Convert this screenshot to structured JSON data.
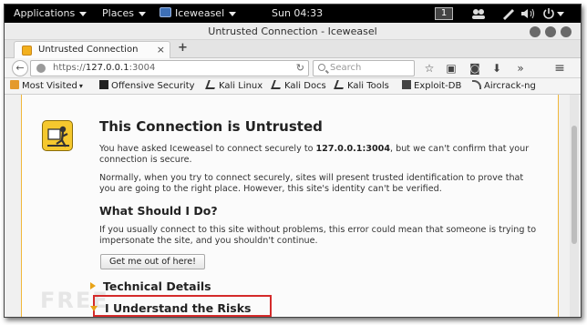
{
  "topbar": {
    "applications": "Applications",
    "places": "Places",
    "app_name": "Iceweasel",
    "clock": "Sun 04:33",
    "workspace": "1"
  },
  "window": {
    "title": "Untrusted Connection - Iceweasel"
  },
  "tabs": [
    {
      "label": "Untrusted Connection"
    }
  ],
  "navbar": {
    "url_scheme": "https://",
    "url_host": "127.0.0.1",
    "url_port": ":3004",
    "search_placeholder": "Search"
  },
  "bookmarks": [
    {
      "label": "Most Visited",
      "icon": "folder-icon"
    },
    {
      "label": "Offensive Security",
      "icon": "offsec-icon"
    },
    {
      "label": "Kali Linux",
      "icon": "kali-dragon-icon"
    },
    {
      "label": "Kali Docs",
      "icon": "kali-dragon-icon"
    },
    {
      "label": "Kali Tools",
      "icon": "kali-dragon-icon"
    },
    {
      "label": "Exploit-DB",
      "icon": "exploitdb-icon"
    },
    {
      "label": "Aircrack-ng",
      "icon": "aircrack-icon"
    }
  ],
  "page": {
    "heading": "This Connection is Untrusted",
    "intro_pre": "You have asked Iceweasel to connect securely to ",
    "intro_host": "127.0.0.1:3004",
    "intro_post": ", but we can't confirm that your connection is secure.",
    "normally": "Normally, when you try to connect securely, sites will present trusted identification to prove that you are going to the right place. However, this site's identity can't be verified.",
    "what_heading": "What Should I Do?",
    "advice": "If you usually connect to this site without problems, this error could mean that someone is trying to impersonate the site, and you shouldn't continue.",
    "get_me_out": "Get me out of here!",
    "technical_details": "Technical Details",
    "understand_risks": "I Understand the Risks"
  },
  "colors": {
    "accent_orange": "#e8a317",
    "highlight_red": "#d42a2a",
    "warning_yellow": "#f5c82e"
  }
}
